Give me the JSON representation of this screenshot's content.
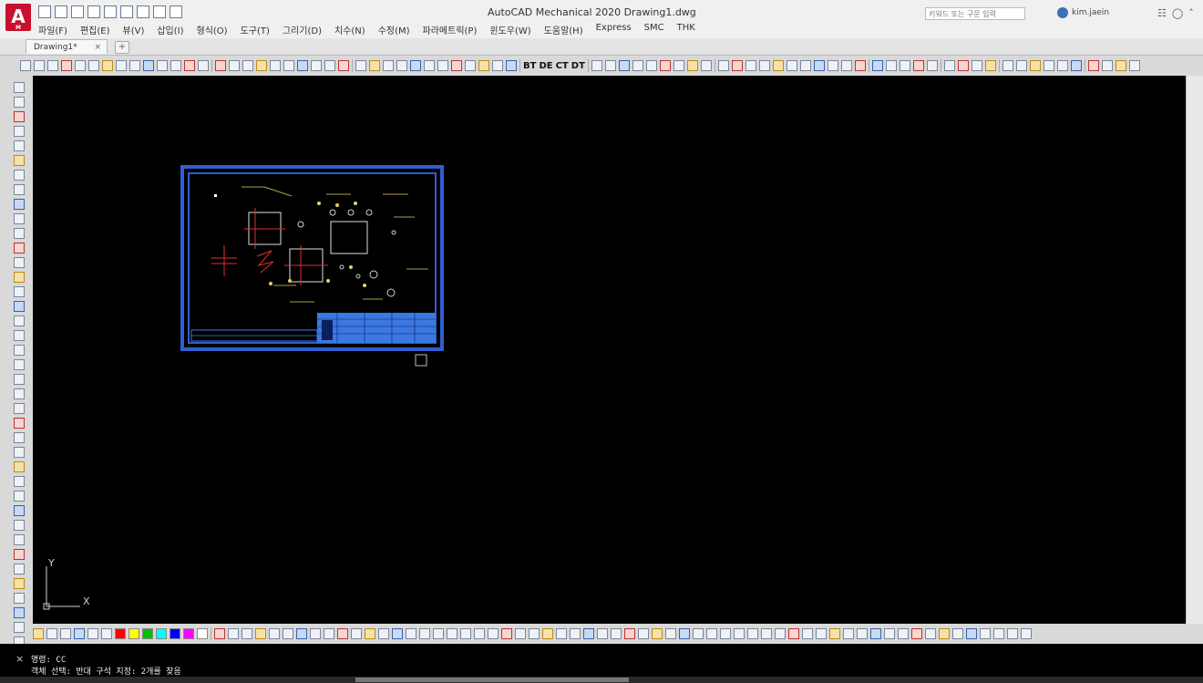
{
  "app": {
    "logo_letter": "A",
    "logo_sub": "M",
    "title": "AutoCAD Mechanical 2020   Drawing1.dwg",
    "search_placeholder": "키워드 또는 구문 입력",
    "user_name": "kim.jaein"
  },
  "menu": [
    "파일(F)",
    "편집(E)",
    "뷰(V)",
    "삽입(I)",
    "형식(O)",
    "도구(T)",
    "그리기(D)",
    "치수(N)",
    "수정(M)",
    "파라메트릭(P)",
    "윈도우(W)",
    "도움말(H)",
    "Express",
    "SMC",
    "THK"
  ],
  "tabs": {
    "active": "Drawing1*",
    "close": "×",
    "new": "+"
  },
  "toolbar_text_buttons": [
    "BT",
    "DE",
    "CT",
    "DT"
  ],
  "ucs": {
    "x_label": "X",
    "y_label": "Y"
  },
  "palette_colors": [
    "#ff0000",
    "#ffff00",
    "#00c000",
    "#00ffff",
    "#0000ff",
    "#ff00ff",
    "#ffffff"
  ],
  "command_line": {
    "close": "×",
    "line1": "명령: CC",
    "line2": "객체 선택: 반대 구석 지정: 2개를 찾음"
  },
  "colors": {
    "canvas": "#000000",
    "sheet_border": "#2f5fd0",
    "title_block": "#3b78e0",
    "geometry_red": "#e03030",
    "geometry_white": "#ffffff",
    "geometry_yellow": "#e8d060"
  }
}
